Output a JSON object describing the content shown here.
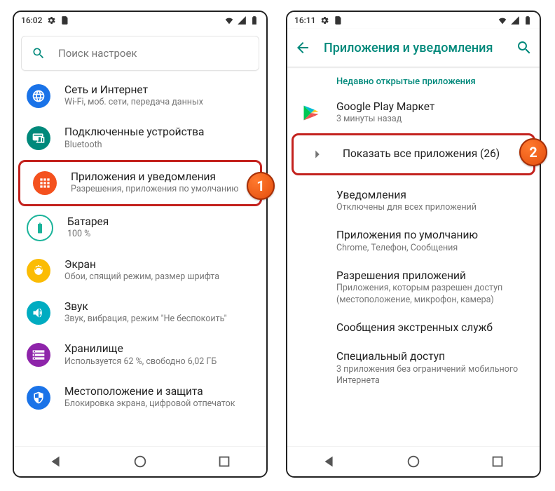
{
  "badges": {
    "b1": "1",
    "b2": "2"
  },
  "phone1": {
    "time": "16:02",
    "search_placeholder": "Поиск настроек",
    "items": [
      {
        "title": "Сеть и Интернет",
        "sub": "Wi-Fi, моб. сети, передача данных"
      },
      {
        "title": "Подключенные устройства",
        "sub": "Bluetooth"
      },
      {
        "title": "Приложения и уведомления",
        "sub": "Разрешения, приложения по умолчанию"
      },
      {
        "title": "Батарея",
        "sub": "100 %"
      },
      {
        "title": "Экран",
        "sub": "Обои, спящий режим, размер шрифта"
      },
      {
        "title": "Звук",
        "sub": "Звук, вибрация, режим \"Не беспокоить\""
      },
      {
        "title": "Хранилище",
        "sub": "Используется 62 %, свободно 6,02 ГБ"
      },
      {
        "title": "Местоположение и защита",
        "sub": "Блокировка экрана, цифровой отпечаток"
      }
    ]
  },
  "phone2": {
    "time": "16:11",
    "appbar_title": "Приложения и уведомления",
    "section_head": "Недавно открытые приложения",
    "recent": {
      "title": "Google Play Маркет",
      "sub": "3 минуты назад"
    },
    "show_all": "Показать все приложения (26)",
    "items": [
      {
        "title": "Уведомления",
        "sub": "Отключены для всех приложений"
      },
      {
        "title": "Приложения по умолчанию",
        "sub": "Chrome, Телефон, Сообщения"
      },
      {
        "title": "Разрешения приложений",
        "sub": "Приложения, которым разрешен доступ (местоположение, микрофон, камера)"
      },
      {
        "title": "Сообщения экстренных служб",
        "sub": ""
      },
      {
        "title": "Специальный доступ",
        "sub": "3 приложения без ограничений мобильного Интернета"
      }
    ]
  }
}
